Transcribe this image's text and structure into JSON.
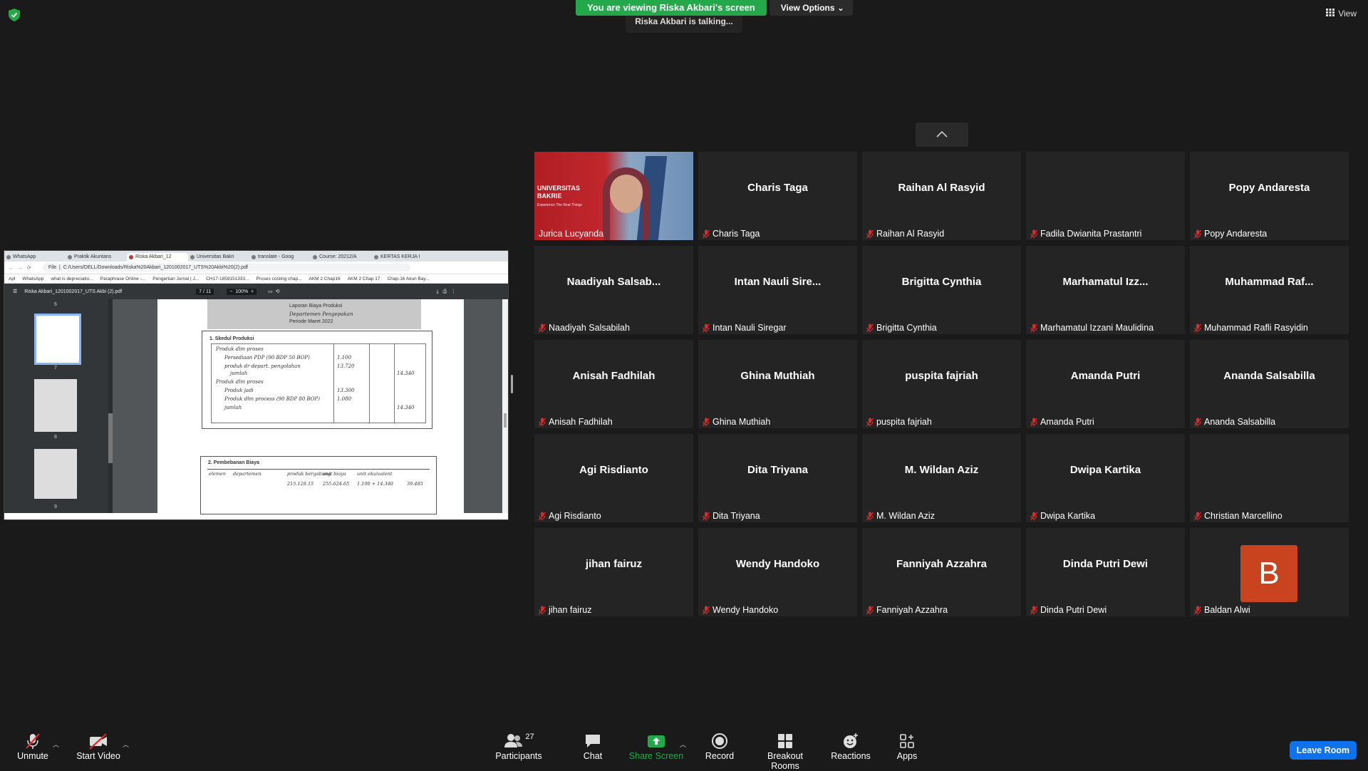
{
  "banner": {
    "viewing_text": "You are viewing Riska Akbari's screen",
    "view_options": "View Options",
    "talking": "Riska Akbari is talking...",
    "view_label": "View"
  },
  "shared_screen": {
    "tabs": [
      "WhatsApp",
      "Praktik Akuntans",
      "Riska Akbari_12",
      "Universitas Bakri",
      "translate - Goog",
      "Course: 20212/A",
      "KERTAS KERJA I"
    ],
    "address_prefix": "File",
    "url": "C:/Users/DELL/Downloads/Riska%20Akbari_1201002017_UTS%20Akbi%20(2).pdf",
    "bookmarks": [
      "Apl",
      "WhatsApp",
      "what is depreciatio...",
      "Paraphrase Online -...",
      "Pengertian Jurnal | J...",
      "CH17-1859151333...",
      "Proses costing chap...",
      "AKM 2 Chap16",
      "AKM 2 Chap 17",
      "Chap-16 Akun Bay..."
    ],
    "pdf_title": "Riska Akbari_1201002017_UTS Akbi (2).pdf",
    "page_current": "7",
    "page_total": "/ 11",
    "zoom": "100%",
    "thumb_numbers": [
      "6",
      "7",
      "8",
      "9"
    ],
    "doc_header": [
      "Laporan Biaya Produksi",
      "Departemen Pengepakan",
      "Periode Maret 2022"
    ],
    "section1": "1.  Skedul Produksi",
    "section1_rows": [
      {
        "label": "Produk dlm proses",
        "value": ""
      },
      {
        "label": "Persediaan PDP (90 BDP 50 BOP)",
        "value": "1.100"
      },
      {
        "label": "produk dr depart. pengolahan",
        "value": "13.720"
      },
      {
        "label": "jumlah",
        "value": "14.340"
      },
      {
        "label": "Produk dlm proses",
        "value": ""
      },
      {
        "label": "Produk jadi",
        "value": "13.300"
      },
      {
        "label": "Produk dlm process (90 BDP 80 BOP)",
        "value": "1.080"
      },
      {
        "label": "jumlah",
        "value": "14.340"
      }
    ],
    "section2": "2.  Pembebanan Biaya",
    "section2_headers": [
      "elemen",
      "departemen",
      "produk bergabung",
      "unit biaya",
      "unit ekuivalent"
    ],
    "section2_first_row": [
      "",
      "",
      "215.128.15",
      "255.624.65",
      "1.100 + 14.340",
      "39.485"
    ]
  },
  "participants": [
    {
      "big": "",
      "name": "Jurica Lucyanda",
      "video": true,
      "video_text": "UNIVERSITAS BAKRIE",
      "video_sub": "Experience The Real Things"
    },
    {
      "big": "Charis Taga",
      "name": "Charis Taga"
    },
    {
      "big": "Raihan Al Rasyid",
      "name": "Raihan Al Rasyid"
    },
    {
      "big": "",
      "name": "Fadila Dwianita Prastantri"
    },
    {
      "big": "Popy Andaresta",
      "name": "Popy Andaresta"
    },
    {
      "big": "Naadiyah  Salsab...",
      "name": "Naadiyah Salsabilah"
    },
    {
      "big": "Intan  Nauli  Sire...",
      "name": "Intan Nauli Siregar"
    },
    {
      "big": "Brigitta Cynthia",
      "name": "Brigitta Cynthia"
    },
    {
      "big": "Marhamatul  Izz...",
      "name": "Marhamatul Izzani Maulidina"
    },
    {
      "big": "Muhammad  Raf...",
      "name": "Muhammad Rafli Rasyidin"
    },
    {
      "big": "Anisah Fadhilah",
      "name": "Anisah Fadhilah"
    },
    {
      "big": "Ghina Muthiah",
      "name": "Ghina Muthiah"
    },
    {
      "big": "puspita fajriah",
      "name": "puspita fajriah"
    },
    {
      "big": "Amanda Putri",
      "name": "Amanda Putri"
    },
    {
      "big": "Ananda Salsabilla",
      "name": "Ananda Salsabilla"
    },
    {
      "big": "Agi Risdianto",
      "name": "Agi Risdianto"
    },
    {
      "big": "Dita Triyana",
      "name": "Dita Triyana"
    },
    {
      "big": "M. Wildan Aziz",
      "name": "M. Wildan Aziz"
    },
    {
      "big": "Dwipa Kartika",
      "name": "Dwipa Kartika"
    },
    {
      "big": "",
      "name": "Christian Marcellino"
    },
    {
      "big": "jihan fairuz",
      "name": "jihan fairuz"
    },
    {
      "big": "Wendy Handoko",
      "name": "Wendy Handoko"
    },
    {
      "big": "Fanniyah Azzahra",
      "name": "Fanniyah Azzahra"
    },
    {
      "big": "Dinda Putri Dewi",
      "name": "Dinda Putri Dewi"
    },
    {
      "big": "",
      "name": "Baldan Alwi",
      "avatar_letter": "B"
    }
  ],
  "toolbar": {
    "unmute": "Unmute",
    "start_video": "Start Video",
    "participants": "Participants",
    "participants_count": "27",
    "chat": "Chat",
    "share_screen": "Share Screen",
    "record": "Record",
    "breakout_rooms": "Breakout Rooms",
    "reactions": "Reactions",
    "apps": "Apps",
    "leave_room": "Leave Room"
  },
  "colors": {
    "share_green": "#23a94a",
    "leave_blue": "#0e72ed",
    "mute_red": "#e02828",
    "avatar_orange": "#c9431e"
  }
}
